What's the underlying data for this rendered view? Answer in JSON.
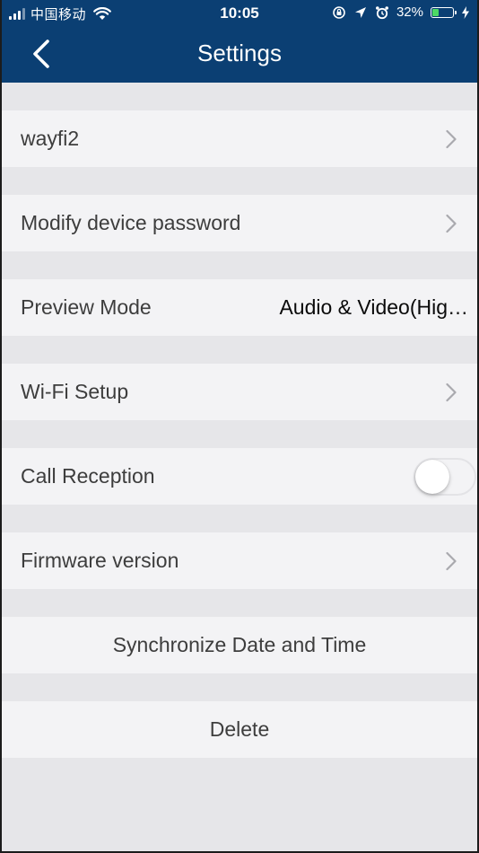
{
  "status_bar": {
    "carrier": "中国移动",
    "time": "10:05",
    "battery_percent": "32%",
    "battery_level": 0.32,
    "icons": [
      "signal-icon",
      "wifi-icon",
      "orientation-lock-icon",
      "location-icon",
      "alarm-icon",
      "battery-icon",
      "charging-icon"
    ]
  },
  "nav": {
    "title": "Settings",
    "back_icon": "back-chevron-icon"
  },
  "settings": {
    "device_name": "wayfi2",
    "modify_password": "Modify device password",
    "preview_mode_label": "Preview Mode",
    "preview_mode_value": "Audio & Video(Hig…",
    "wifi_setup": "Wi-Fi Setup",
    "call_reception_label": "Call Reception",
    "call_reception_on": false,
    "firmware_version": "Firmware version",
    "sync_date_time": "Synchronize Date and Time",
    "delete": "Delete"
  },
  "colors": {
    "nav_background": "#0b3f73",
    "row_background": "#f3f3f5",
    "group_gap": "#e6e6e9",
    "battery_fill": "#4cd964"
  }
}
